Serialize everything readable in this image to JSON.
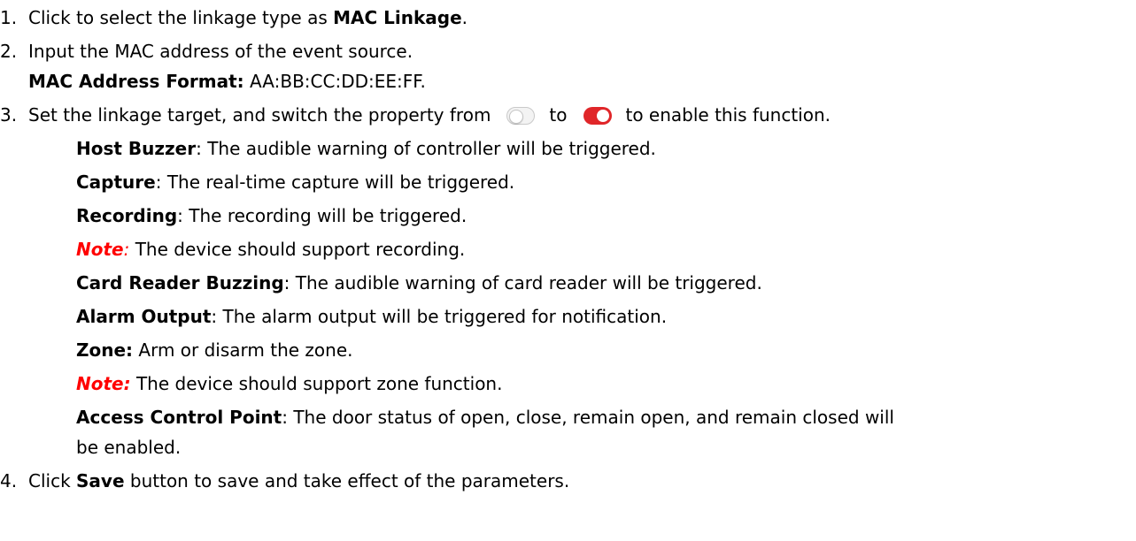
{
  "steps": [
    {
      "number": "1.",
      "prefix": "Click to select the linkage type as ",
      "bold": "MAC Linkage",
      "suffix": "."
    },
    {
      "number": "2.",
      "text": "Input the MAC address of the event source.",
      "format_label": "MAC Address Format:",
      "format_value": " AA:BB:CC:DD:EE:FF."
    },
    {
      "number": "3.",
      "text_a": "Set the linkage target, and switch the property from",
      "text_b": "to",
      "text_c": "to enable this function.",
      "toggle_off_icon": "toggle-off-icon",
      "toggle_on_icon": "toggle-on-icon",
      "toggle_on_color": "#e02629",
      "items": [
        {
          "label": "Host Buzzer",
          "sep": ": ",
          "desc": "The audible warning of controller will be triggered."
        },
        {
          "label": "Capture",
          "sep": ": ",
          "desc": "The real-time capture will be triggered."
        },
        {
          "label": "Recording",
          "sep": ": ",
          "desc": "The recording will be triggered."
        },
        {
          "note_label": "Note",
          "note_colon": ":",
          "desc": " The device should support recording."
        },
        {
          "label": "Card Reader Buzzing",
          "sep": ": ",
          "desc": "The audible warning of card reader will be triggered."
        },
        {
          "label": "Alarm Output",
          "sep": ": ",
          "desc": "The alarm output will be triggered for notification."
        },
        {
          "label": "Zone:",
          "desc": " Arm or disarm the zone."
        },
        {
          "note_label": "Note:",
          "desc": " The device should support zone function."
        },
        {
          "label": "Access Control Point",
          "sep": ": ",
          "desc": "The door status of open, close, remain open, and remain closed will",
          "desc_cont": "be enabled."
        }
      ]
    },
    {
      "number": "4.",
      "prefix": "Click ",
      "bold": "Save",
      "suffix": " button to save and take effect of the parameters."
    }
  ]
}
